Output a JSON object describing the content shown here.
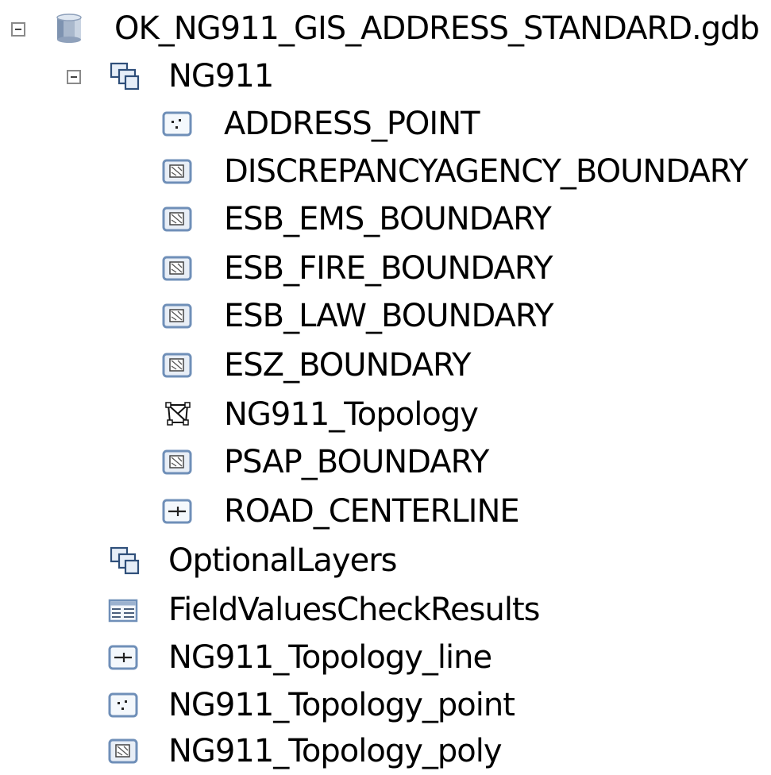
{
  "tree": {
    "root": {
      "label": "OK_NG911_GIS_ADDRESS_STANDARD.gdb",
      "icon": "geodatabase-icon"
    },
    "ng911_dataset": {
      "label": "NG911",
      "icon": "feature-dataset-icon"
    },
    "ng911_children": [
      {
        "label": "ADDRESS_POINT",
        "icon": "point-feature-class-icon"
      },
      {
        "label": "DISCREPANCYAGENCY_BOUNDARY",
        "icon": "polygon-feature-class-icon"
      },
      {
        "label": "ESB_EMS_BOUNDARY",
        "icon": "polygon-feature-class-icon"
      },
      {
        "label": "ESB_FIRE_BOUNDARY",
        "icon": "polygon-feature-class-icon"
      },
      {
        "label": "ESB_LAW_BOUNDARY",
        "icon": "polygon-feature-class-icon"
      },
      {
        "label": "ESZ_BOUNDARY",
        "icon": "polygon-feature-class-icon"
      },
      {
        "label": "NG911_Topology",
        "icon": "topology-icon"
      },
      {
        "label": "PSAP_BOUNDARY",
        "icon": "polygon-feature-class-icon"
      },
      {
        "label": "ROAD_CENTERLINE",
        "icon": "line-feature-class-icon"
      }
    ],
    "root_children": [
      {
        "label": "OptionalLayers",
        "icon": "feature-dataset-icon"
      },
      {
        "label": "FieldValuesCheckResults",
        "icon": "table-icon"
      },
      {
        "label": "NG911_Topology_line",
        "icon": "line-feature-class-icon"
      },
      {
        "label": "NG911_Topology_point",
        "icon": "point-feature-class-icon"
      },
      {
        "label": "NG911_Topology_poly",
        "icon": "polygon-feature-class-icon"
      }
    ]
  },
  "colors": {
    "icon_blue": "#6f8fb8",
    "icon_fill": "#dde7f3",
    "expander_border": "#8a8a8a"
  }
}
